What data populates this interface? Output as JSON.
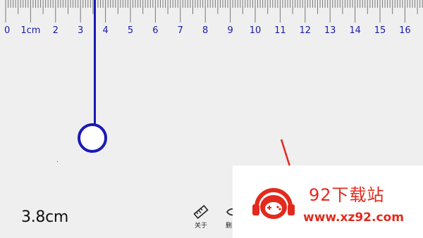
{
  "ruler": {
    "labels": [
      "0",
      "1cm",
      "2",
      "3",
      "4",
      "5",
      "6",
      "7",
      "8",
      "9",
      "10",
      "11",
      "12",
      "13",
      "14",
      "15",
      "16"
    ],
    "unit": "cm",
    "color": "#1a1aa8"
  },
  "measurement": {
    "value_cm": 3.8,
    "text": "3.8cm"
  },
  "toolbar": {
    "about_label": "关于",
    "second_label": "删"
  },
  "watermark": {
    "title": "92下载站",
    "url": "www.xz92.com",
    "color": "#e22a1d"
  },
  "colors": {
    "accent": "#1a1ab5",
    "background": "#efefef"
  }
}
